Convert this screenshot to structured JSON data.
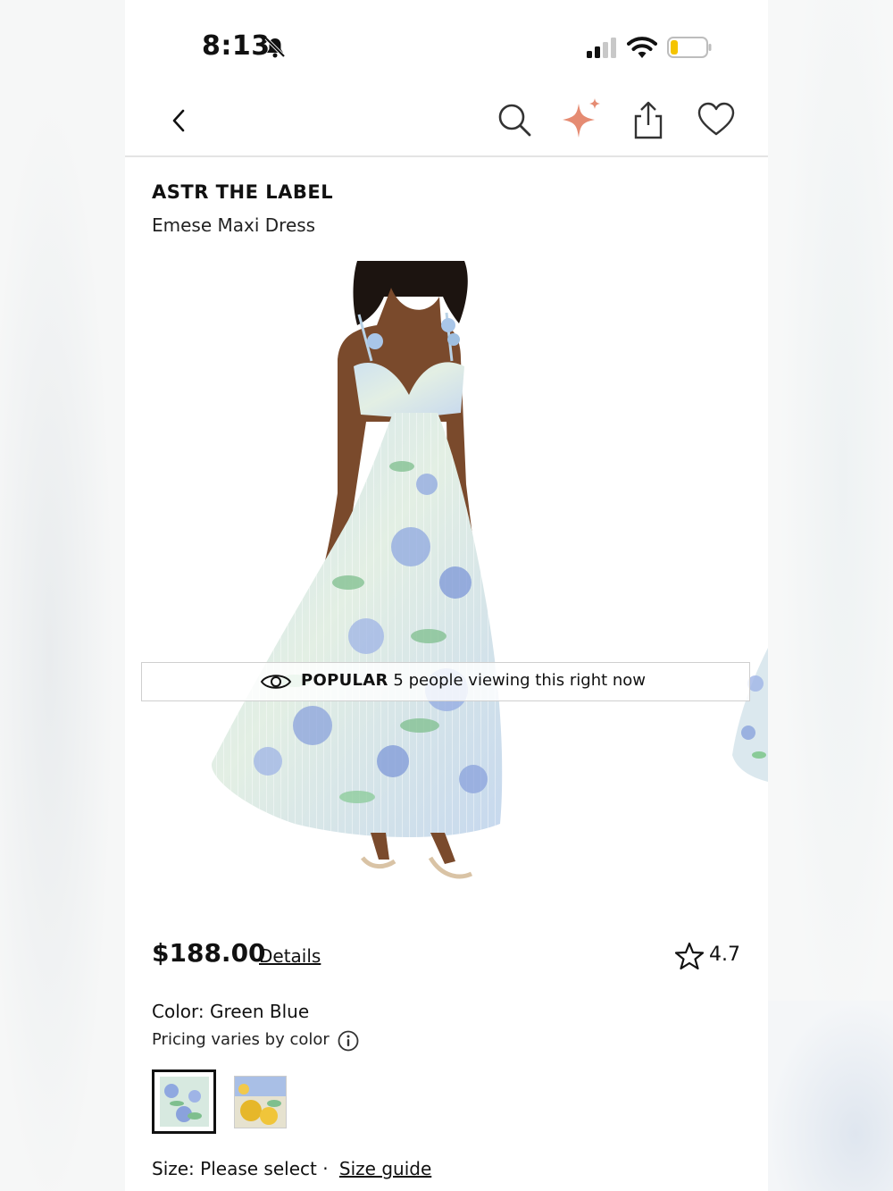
{
  "status_bar": {
    "time": "8:13"
  },
  "nav": {
    "back_icon": "chevron-left-icon",
    "icons": [
      "search-icon",
      "sparkle-icon",
      "share-icon",
      "heart-icon"
    ],
    "sparkle_color": "#e58b72"
  },
  "product": {
    "brand": "ASTR THE LABEL",
    "name": "Emese Maxi Dress"
  },
  "banner": {
    "label": "POPULAR",
    "text": " 5 people viewing this right now"
  },
  "pricing": {
    "price": "$188.00",
    "details_link": "Details",
    "rating": "4.7"
  },
  "color": {
    "label": "Color: Green Blue",
    "pricing_note": "Pricing varies by color",
    "swatches": [
      "Green Blue",
      "Yellow Blue"
    ],
    "selected_index": 0
  },
  "size": {
    "label": "Size: Please select",
    "separator": " · ",
    "guide_link": "Size guide"
  }
}
